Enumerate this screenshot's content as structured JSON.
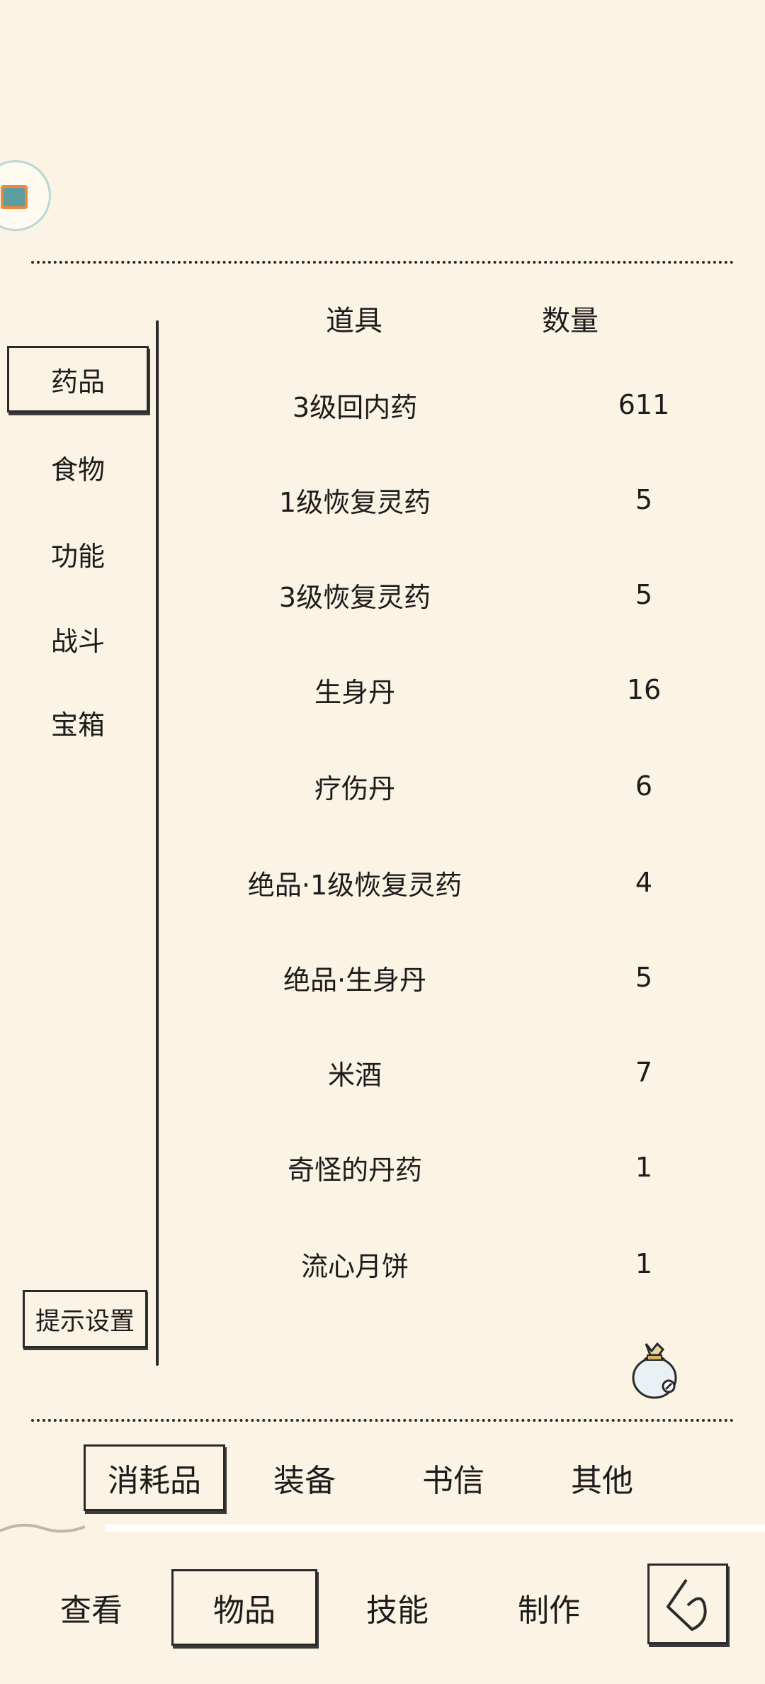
{
  "colors": {
    "background": "#fbf3e3",
    "ink": "#1c1c1c"
  },
  "categories": [
    {
      "label": "药品",
      "active": true
    },
    {
      "label": "食物",
      "active": false
    },
    {
      "label": "功能",
      "active": false
    },
    {
      "label": "战斗",
      "active": false
    },
    {
      "label": "宝箱",
      "active": false
    }
  ],
  "hint_settings": "提示设置",
  "table": {
    "headers": {
      "item": "道具",
      "count": "数量"
    },
    "rows": [
      {
        "name": "3级回内药",
        "count": "611"
      },
      {
        "name": "1级恢复灵药",
        "count": "5"
      },
      {
        "name": "3级恢复灵药",
        "count": "5"
      },
      {
        "name": "生身丹",
        "count": "16"
      },
      {
        "name": "疗伤丹",
        "count": "6"
      },
      {
        "name": "绝品·1级恢复灵药",
        "count": "4"
      },
      {
        "name": "绝品·生身丹",
        "count": "5"
      },
      {
        "name": "米酒",
        "count": "7"
      },
      {
        "name": "奇怪的丹药",
        "count": "1"
      },
      {
        "name": "流心月饼",
        "count": "1"
      }
    ]
  },
  "sub_tabs": [
    {
      "label": "消耗品",
      "active": true
    },
    {
      "label": "装备",
      "active": false
    },
    {
      "label": "书信",
      "active": false
    },
    {
      "label": "其他",
      "active": false
    }
  ],
  "nav_tabs": [
    {
      "label": "查看",
      "active": false
    },
    {
      "label": "物品",
      "active": true
    },
    {
      "label": "技能",
      "active": false
    },
    {
      "label": "制作",
      "active": false
    }
  ],
  "icons": {
    "avatar": "avatar-icon",
    "bag": "money-bag-icon",
    "back": "back-arrow-icon"
  }
}
